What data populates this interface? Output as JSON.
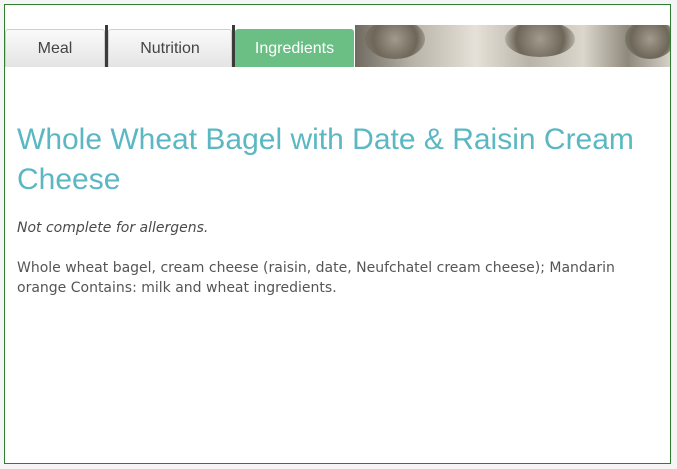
{
  "tabs": {
    "meal": "Meal",
    "nutrition": "Nutrition",
    "ingredients": "Ingredients",
    "active": "Ingredients"
  },
  "colors": {
    "active_tab": "#6bbf84",
    "title": "#5bb8c2",
    "frame_border": "#2e7d32"
  },
  "main": {
    "title": "Whole Wheat Bagel with Date & Raisin Cream Cheese",
    "note": "Not complete for allergens.",
    "ingredients": "Whole wheat bagel, cream cheese (raisin, date, Neufchatel cream cheese); Mandarin orange Contains: milk and wheat ingredients."
  }
}
